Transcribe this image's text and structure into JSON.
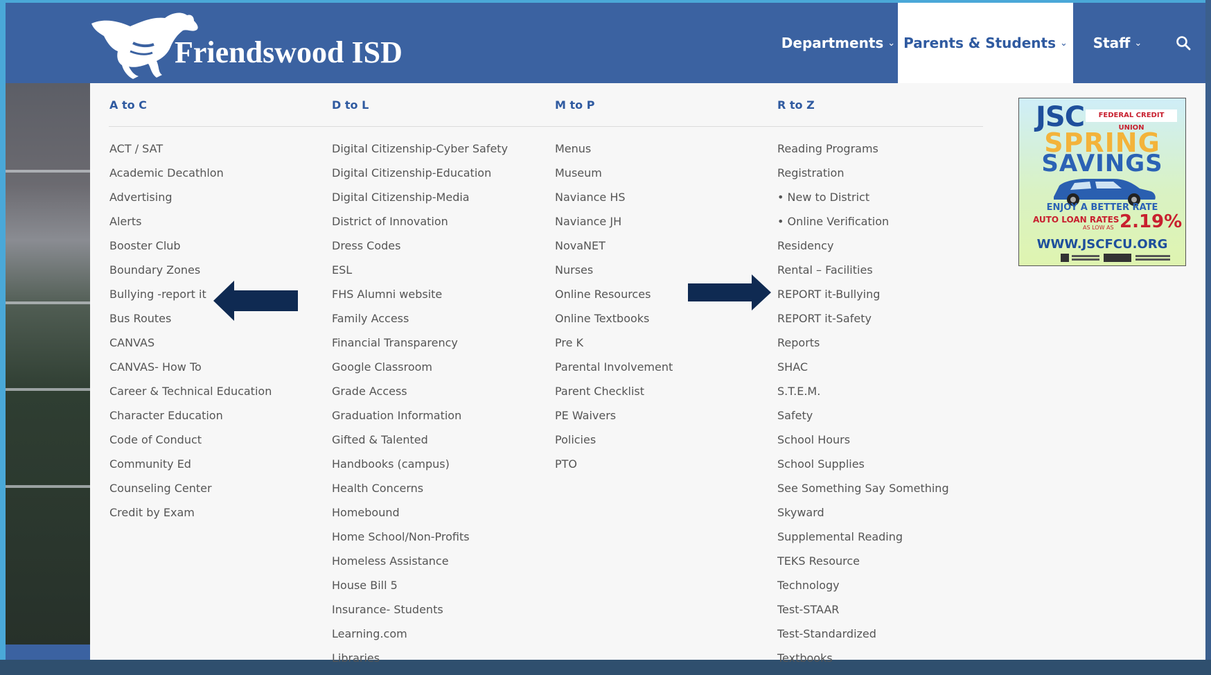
{
  "brand": {
    "name": "Friendswood ISD",
    "logo_icon": "mustang-horse-icon"
  },
  "nav": [
    {
      "label": "Departments",
      "active": false
    },
    {
      "label": "Parents & Students",
      "active": true
    },
    {
      "label": "Staff",
      "active": false
    }
  ],
  "search_icon": "search-icon",
  "menu": {
    "columns": [
      {
        "heading": "A to C",
        "items": [
          "ACT / SAT",
          "Academic Decathlon",
          "Advertising",
          "Alerts",
          "Booster Club",
          "Boundary Zones",
          "Bullying -report it",
          "Bus Routes",
          "CANVAS",
          "CANVAS- How To",
          "Career & Technical Education",
          "Character Education",
          "Code of Conduct",
          "Community Ed",
          "Counseling Center",
          "Credit by Exam"
        ]
      },
      {
        "heading": "D to L",
        "items": [
          "Digital Citizenship-Cyber Safety",
          "Digital Citizenship-Education",
          "Digital Citizenship-Media",
          "District of Innovation",
          "Dress Codes",
          "ESL",
          "FHS Alumni website",
          "Family Access",
          "Financial Transparency",
          "Google Classroom",
          "Grade Access",
          "Graduation Information",
          "Gifted & Talented",
          "Handbooks (campus)",
          "Health Concerns",
          "Homebound",
          "Home School/Non-Profits",
          "Homeless Assistance",
          "House Bill 5",
          "Insurance- Students",
          "Learning.com",
          "Libraries"
        ]
      },
      {
        "heading": "M to P",
        "items": [
          "Menus",
          "Museum",
          "Naviance HS",
          "Naviance JH",
          "NovaNET",
          "Nurses",
          "Online Resources",
          "Online Textbooks",
          "Pre K",
          "Parental Involvement",
          "Parent Checklist",
          "PE Waivers",
          "Policies",
          "PTO"
        ]
      },
      {
        "heading": "R to Z",
        "items": [
          "Reading Programs",
          "Registration",
          "• New to District",
          "• Online Verification",
          "Residency",
          "Rental – Facilities",
          "REPORT it-Bullying",
          "REPORT it-Safety",
          "Reports",
          "SHAC",
          "S.T.E.M.",
          "Safety",
          "School Hours",
          "School Supplies",
          "See Something Say Something",
          "Skyward",
          "Supplemental Reading",
          "TEKS Resource",
          "Technology",
          "Test-STAAR",
          "Test-Standardized",
          "Textbooks"
        ]
      }
    ]
  },
  "ad": {
    "brand": "JSC",
    "tagline": "FEDERAL CREDIT UNION",
    "line1": "SPRING",
    "line2": "SAVINGS",
    "line3": "ENJOY A BETTER RATE",
    "rates_label": "AUTO LOAN RATES",
    "as_low_as": "AS LOW AS",
    "rate": "2.19%",
    "url": "WWW.JSCFCU.ORG"
  },
  "colors": {
    "header": "#3b62a1",
    "accent": "#2f5aa0",
    "arrow": "#0f2a52"
  }
}
